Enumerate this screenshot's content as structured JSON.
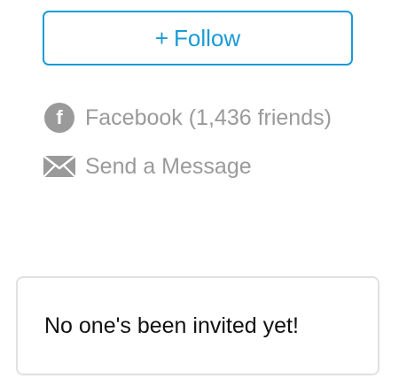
{
  "follow": {
    "icon": "plus-icon",
    "plus": "+",
    "label": "Follow"
  },
  "contacts": {
    "facebook": {
      "icon": "facebook-icon",
      "icon_glyph": "f",
      "label": "Facebook (1,436 friends)"
    },
    "message": {
      "icon": "envelope-icon",
      "label": "Send a Message"
    }
  },
  "invites": {
    "empty_text": "No one's been invited yet!"
  },
  "colors": {
    "accent": "#1a9bd7",
    "muted": "#9a9a9a",
    "border": "#e1e1e1",
    "text": "#111111"
  }
}
